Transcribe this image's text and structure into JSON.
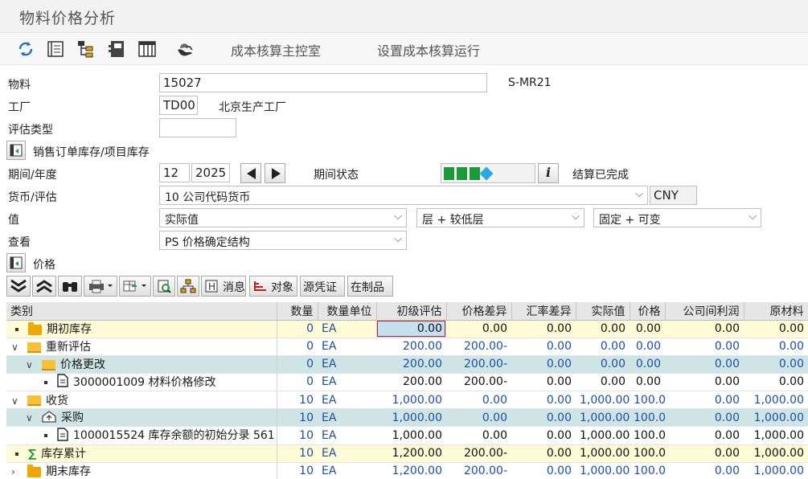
{
  "window": {
    "title": "物料价格分析"
  },
  "app_toolbar": {
    "icons": [
      "refresh-icon",
      "document-icon",
      "hierarchy-icon",
      "save-icon",
      "table-icon",
      "hand-icon"
    ],
    "cost_cockpit": "成本核算主控室",
    "set_cost_run": "设置成本核算运行"
  },
  "form": {
    "material_label": "物料",
    "material_value": "15027",
    "material_desc": "S-MR21",
    "plant_label": "工厂",
    "plant_value": "TD00",
    "plant_desc": "北京生产工厂",
    "valtype_label": "评估类型",
    "valtype_value": "",
    "sales_order_label": "销售订单库存/项目库存",
    "period_label": "期间/年度",
    "period_value": "12",
    "year_value": "2025",
    "period_status_label": "期间状态",
    "period_status_text": "结算已完成",
    "currency_label": "货币/评估",
    "currency_value": "10 公司代码货币",
    "currency_code": "CNY",
    "value_label": "值",
    "value_select": "实际值",
    "level_select": "层 + 较低层",
    "fixvar_select": "固定 + 可变",
    "view_label": "查看",
    "view_select": "PS 价格确定结构",
    "price_section_label": "价格"
  },
  "grid_toolbar": {
    "messages": "消息",
    "object": "对象",
    "source_doc": "源凭证",
    "wip": "在制品"
  },
  "table": {
    "headers": [
      "类别",
      "数量",
      "数量单位",
      "初级评估",
      "价格差异",
      "汇率差异",
      "实际值",
      "价格",
      "公司间利润",
      "原材料"
    ],
    "rows": [
      {
        "style": "yellow",
        "marker": "bullet",
        "icon": "folder",
        "label": "期初库存",
        "indent": 0,
        "qty": "0",
        "unit": "EA",
        "prim": "0.00",
        "pdiff": "0.00",
        "xdiff": "0.00",
        "actual": "0.00",
        "price": "0.00",
        "icprofit": "0.00",
        "raw": "0.00",
        "color": "black"
      },
      {
        "style": "white",
        "marker": "chevron-down",
        "icon": "openfolder",
        "label": "重新评估",
        "indent": 0,
        "qty": "0",
        "unit": "EA",
        "prim": "200.00",
        "pdiff": "200.00-",
        "xdiff": "0.00",
        "actual": "0.00",
        "price": "0.00",
        "icprofit": "0.00",
        "raw": "0.00",
        "color": "blue"
      },
      {
        "style": "teal",
        "marker": "chevron-down",
        "icon": "openfolder",
        "label": "价格更改",
        "indent": 1,
        "qty": "0",
        "unit": "EA",
        "prim": "200.00",
        "pdiff": "200.00-",
        "xdiff": "0.00",
        "actual": "0.00",
        "price": "0.00",
        "icprofit": "0.00",
        "raw": "0.00",
        "color": "blue"
      },
      {
        "style": "white",
        "marker": "bullet",
        "icon": "doc",
        "label": "3000001009 材料价格修改",
        "indent": 2,
        "qty": "0",
        "unit": "EA",
        "prim": "200.00",
        "pdiff": "200.00-",
        "xdiff": "0.00",
        "actual": "0.00",
        "price": "0.00",
        "icprofit": "0.00",
        "raw": "0.00",
        "color": "black"
      },
      {
        "style": "white",
        "marker": "chevron-down",
        "icon": "openfolder",
        "label": "收货",
        "indent": 0,
        "qty": "10",
        "unit": "EA",
        "prim": "1,000.00",
        "pdiff": "0.00",
        "xdiff": "0.00",
        "actual": "1,000.00",
        "price": "100.00",
        "icprofit": "0.00",
        "raw": "1,000.00",
        "color": "blue"
      },
      {
        "style": "teal",
        "marker": "chevron-down",
        "icon": "cart",
        "label": "采购",
        "indent": 1,
        "qty": "10",
        "unit": "EA",
        "prim": "1,000.00",
        "pdiff": "0.00",
        "xdiff": "0.00",
        "actual": "1,000.00",
        "price": "100.00",
        "icprofit": "0.00",
        "raw": "1,000.00",
        "color": "blue"
      },
      {
        "style": "white",
        "marker": "bullet",
        "icon": "doc",
        "label": "1000015524 库存余额的初始分录 561",
        "indent": 2,
        "qty": "10",
        "unit": "EA",
        "prim": "1,000.00",
        "pdiff": "0.00",
        "xdiff": "0.00",
        "actual": "1,000.00",
        "price": "100.00",
        "icprofit": "0.00",
        "raw": "1,000.00",
        "color": "black"
      },
      {
        "style": "yellow",
        "marker": "bullet",
        "icon": "sigma",
        "label": "库存累计",
        "indent": 0,
        "qty": "10",
        "unit": "EA",
        "prim": "1,200.00",
        "pdiff": "200.00-",
        "xdiff": "0.00",
        "actual": "1,000.00",
        "price": "100.00",
        "icprofit": "0.00",
        "raw": "1,000.00",
        "color": "black"
      },
      {
        "style": "white",
        "marker": "chevron-right",
        "icon": "folder",
        "label": "期末库存",
        "indent": 0,
        "qty": "10",
        "unit": "EA",
        "prim": "1,200.00",
        "pdiff": "200.00-",
        "xdiff": "0.00",
        "actual": "1,000.00",
        "price": "100.00",
        "icprofit": "0.00",
        "raw": "1,000.00",
        "color": "blue"
      }
    ]
  },
  "colors": {
    "row_yellow": "#fefbd6",
    "row_teal": "#cfe4e4",
    "value_blue": "#1b4ea8",
    "status_green": "#1b9a3a",
    "status_blue": "#28a9e6"
  }
}
